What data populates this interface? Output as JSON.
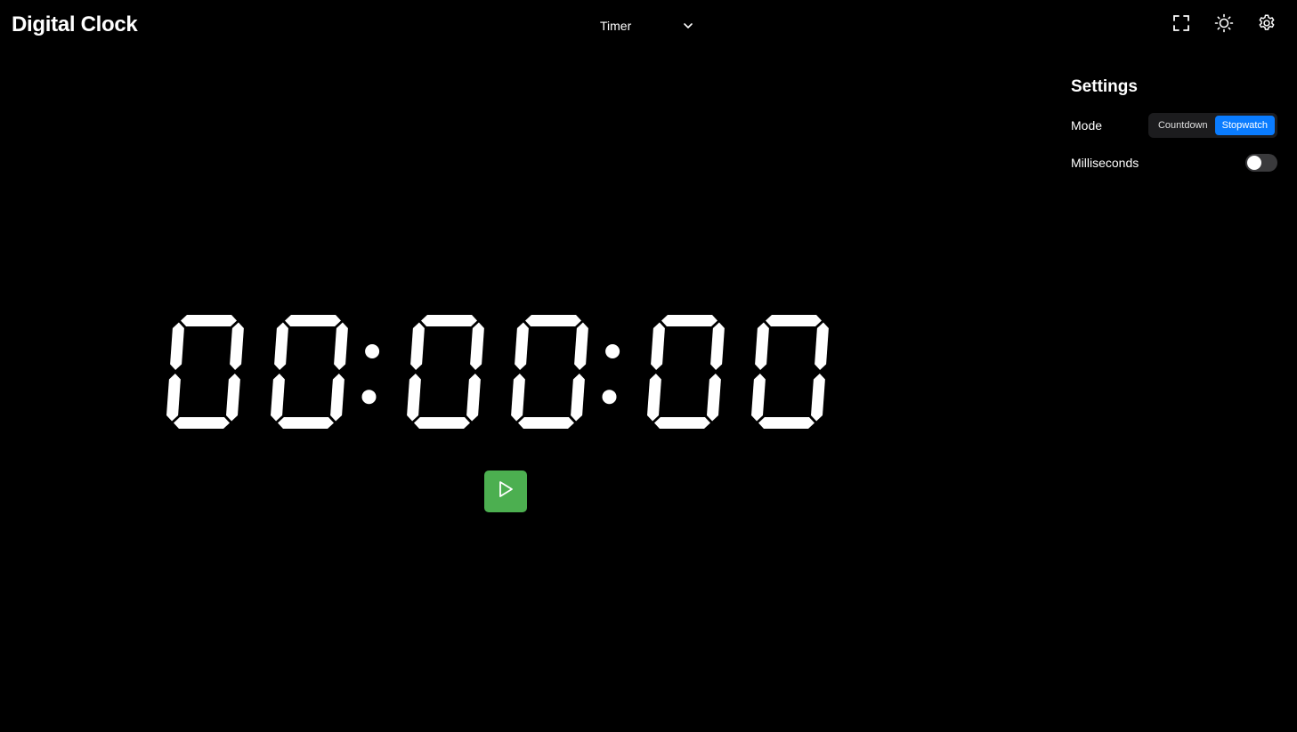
{
  "header": {
    "app_title": "Digital Clock",
    "mode_select": {
      "selected": "Timer"
    },
    "icons": [
      "fullscreen-icon",
      "brightness-icon",
      "settings-gear-icon"
    ]
  },
  "settings": {
    "title": "Settings",
    "mode": {
      "label": "Mode",
      "options": [
        "Countdown",
        "Stopwatch"
      ],
      "selected": "Stopwatch"
    },
    "milliseconds": {
      "label": "Milliseconds",
      "enabled": false
    }
  },
  "display": {
    "time": "00:00:00",
    "color": "#ffffff"
  },
  "controls": {
    "play_icon": "play-icon",
    "play_color": "#4caf50"
  },
  "colors": {
    "background": "#000000",
    "accent": "#0a7cff"
  }
}
